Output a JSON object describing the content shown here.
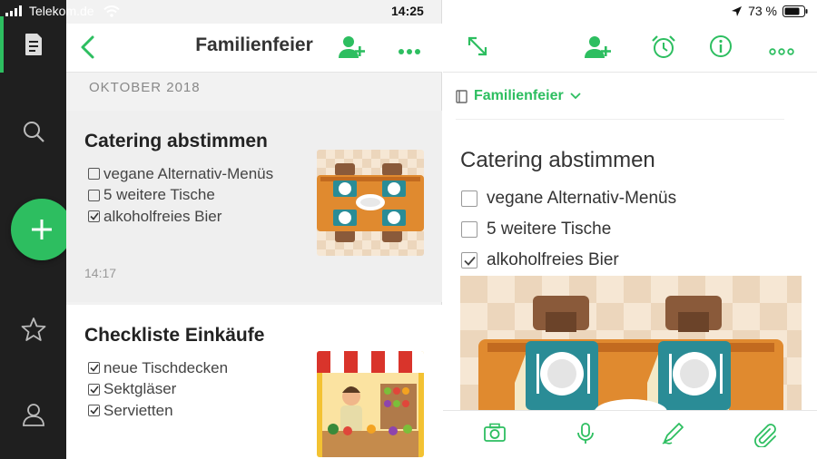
{
  "status_bar": {
    "carrier": "Telekom.de",
    "time": "14:25",
    "battery_percent": "73 %"
  },
  "list": {
    "title": "Familienfeier",
    "section_label": "OKTOBER 2018",
    "notes": [
      {
        "title": "Catering abstimmen",
        "items": [
          {
            "text": "vegane Alternativ-Menüs",
            "checked": false
          },
          {
            "text": "5 weitere Tische",
            "checked": false
          },
          {
            "text": "alkoholfreies Bier",
            "checked": true
          }
        ],
        "time": "14:17"
      },
      {
        "title": "Checkliste Einkäufe",
        "items": [
          {
            "text": "neue Tischdecken",
            "checked": true
          },
          {
            "text": "Sektgläser",
            "checked": true
          },
          {
            "text": "Servietten",
            "checked": true
          }
        ]
      }
    ]
  },
  "editor": {
    "notebook": "Familienfeier",
    "title": "Catering abstimmen",
    "items": [
      {
        "text": "vegane Alternativ-Menüs",
        "checked": false
      },
      {
        "text": "5 weitere Tische",
        "checked": false
      },
      {
        "text": "alkoholfreies Bier",
        "checked": true
      }
    ]
  },
  "colors": {
    "accent": "#2dbe60",
    "rail": "#1f1f1f"
  }
}
